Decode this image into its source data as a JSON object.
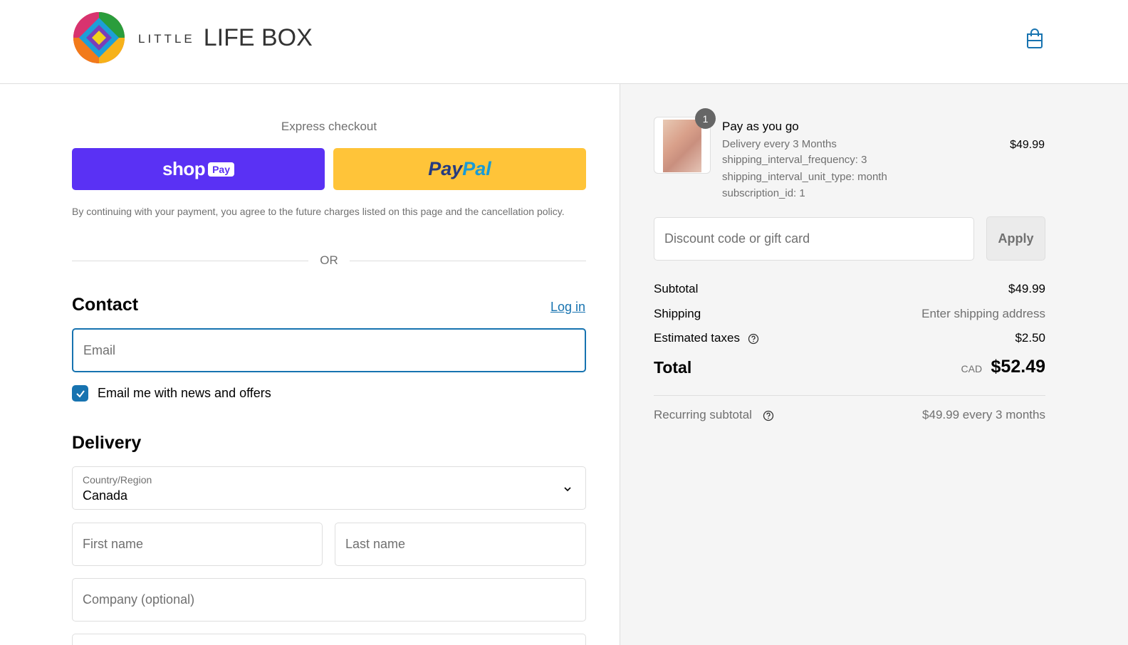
{
  "header": {
    "logo_small": "LITTLE",
    "logo_big": "LIFE BOX",
    "cart_icon": "shopping-bag-icon"
  },
  "express": {
    "label": "Express checkout",
    "shoppay_word": "shop",
    "shoppay_pill": "Pay",
    "paypal_pay": "Pay",
    "paypal_pal": "Pal",
    "policy": "By continuing with your payment, you agree to the future charges listed on this page and the cancellation policy.",
    "or": "OR"
  },
  "contact": {
    "title": "Contact",
    "login": "Log in",
    "email_placeholder": "Email",
    "newsletter_label": "Email me with news and offers",
    "newsletter_checked": true
  },
  "delivery": {
    "title": "Delivery",
    "country_label": "Country/Region",
    "country_value": "Canada",
    "first_name_placeholder": "First name",
    "last_name_placeholder": "Last name",
    "company_placeholder": "Company (optional)"
  },
  "order": {
    "item": {
      "quantity": "1",
      "title": "Pay as you go",
      "lines": [
        "Delivery every 3 Months",
        "shipping_interval_frequency: 3",
        "shipping_interval_unit_type: month",
        "subscription_id: 1"
      ],
      "price": "$49.99"
    },
    "discount_placeholder": "Discount code or gift card",
    "apply": "Apply",
    "subtotal_label": "Subtotal",
    "subtotal_value": "$49.99",
    "shipping_label": "Shipping",
    "shipping_value": "Enter shipping address",
    "taxes_label": "Estimated taxes",
    "taxes_value": "$2.50",
    "total_label": "Total",
    "total_currency": "CAD",
    "total_value": "$52.49",
    "recurring_label": "Recurring subtotal",
    "recurring_value": "$49.99 every 3 months"
  },
  "colors": {
    "accent": "#1773b0",
    "shoppay": "#5a31f4",
    "paypal": "#ffc439",
    "sidebar_bg": "#f5f5f5"
  }
}
